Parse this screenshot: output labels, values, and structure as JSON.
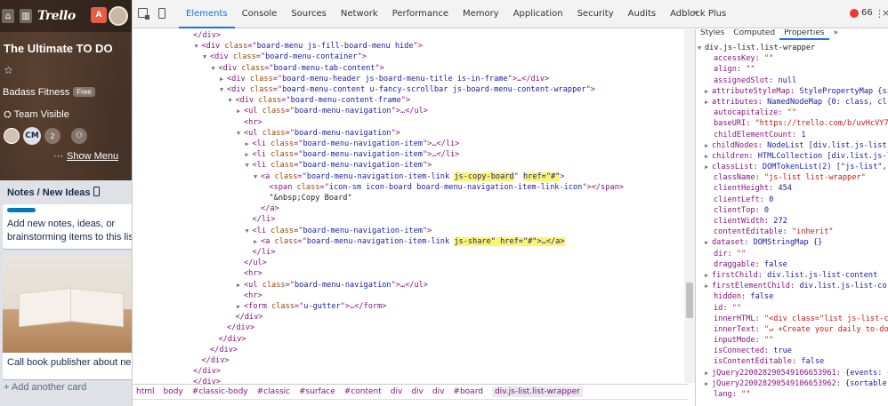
{
  "trello": {
    "logo": "Trello",
    "notif_count": "A",
    "board_title": "The Ultimate TO DO",
    "team_name": "Badass Fitness",
    "free_badge": "Free",
    "visibility": "Team Visible",
    "member_initials": "CM",
    "member_count": "2",
    "show_menu": "Show Menu",
    "show_menu_icon": "···",
    "list_title": "Notes / New Ideas",
    "card1_line1": "Add new notes, ideas, or",
    "card1_line2": "brainstorming items to this lis",
    "card2_text": "Call book publisher about ne",
    "add_card": "+ Add another card",
    "accent_color": "#0079bf"
  },
  "devtools": {
    "tabs": [
      "Elements",
      "Console",
      "Sources",
      "Network",
      "Performance",
      "Memory",
      "Application",
      "Security",
      "Audits",
      "Adblock Plus"
    ],
    "active_tab": "Elements",
    "more_tabs": "»",
    "error_count": "66",
    "kebab": "⋮",
    "close": "×",
    "code_lines": [
      {
        "i": 0,
        "tw": "",
        "parts": [
          [
            "tag",
            "</div>"
          ]
        ]
      },
      {
        "i": 1,
        "tw": "▼",
        "parts": [
          [
            "tag",
            "<div "
          ],
          [
            "attr",
            "class"
          ],
          [
            "tag",
            "=\""
          ],
          [
            "val",
            "board-menu js-fill-board-menu hide"
          ],
          [
            "tag",
            "\">"
          ]
        ]
      },
      {
        "i": 2,
        "tw": "▼",
        "parts": [
          [
            "tag",
            "<div "
          ],
          [
            "attr",
            "class"
          ],
          [
            "tag",
            "=\""
          ],
          [
            "val",
            "board-menu-container"
          ],
          [
            "tag",
            "\">"
          ]
        ]
      },
      {
        "i": 3,
        "tw": "▼",
        "parts": [
          [
            "tag",
            "<div "
          ],
          [
            "attr",
            "class"
          ],
          [
            "tag",
            "=\""
          ],
          [
            "val",
            "board-menu-tab-content"
          ],
          [
            "tag",
            "\">"
          ]
        ]
      },
      {
        "i": 4,
        "tw": "▶",
        "parts": [
          [
            "tag",
            "<div "
          ],
          [
            "attr",
            "class"
          ],
          [
            "tag",
            "=\""
          ],
          [
            "val",
            "board-menu-header js-board-menu-title is-in-frame"
          ],
          [
            "tag",
            "\">…</div>"
          ]
        ]
      },
      {
        "i": 4,
        "tw": "▼",
        "parts": [
          [
            "tag",
            "<div "
          ],
          [
            "attr",
            "class"
          ],
          [
            "tag",
            "=\""
          ],
          [
            "val",
            "board-menu-content u-fancy-scrollbar js-board-menu-content-wrapper"
          ],
          [
            "tag",
            "\">"
          ]
        ]
      },
      {
        "i": 5,
        "tw": "▼",
        "parts": [
          [
            "tag",
            "<div "
          ],
          [
            "attr",
            "class"
          ],
          [
            "tag",
            "=\""
          ],
          [
            "val",
            "board-menu-content-frame"
          ],
          [
            "tag",
            "\">"
          ]
        ]
      },
      {
        "i": 6,
        "tw": "▶",
        "parts": [
          [
            "tag",
            "<ul "
          ],
          [
            "attr",
            "class"
          ],
          [
            "tag",
            "=\""
          ],
          [
            "val",
            "board-menu-navigation"
          ],
          [
            "tag",
            "\">…</ul>"
          ]
        ]
      },
      {
        "i": 6,
        "tw": "",
        "parts": [
          [
            "tag",
            "<hr>"
          ]
        ]
      },
      {
        "i": 6,
        "tw": "▼",
        "parts": [
          [
            "tag",
            "<ul "
          ],
          [
            "attr",
            "class"
          ],
          [
            "tag",
            "=\""
          ],
          [
            "val",
            "board-menu-navigation"
          ],
          [
            "tag",
            "\">"
          ]
        ]
      },
      {
        "i": 7,
        "tw": "▶",
        "parts": [
          [
            "tag",
            "<li "
          ],
          [
            "attr",
            "class"
          ],
          [
            "tag",
            "=\""
          ],
          [
            "val",
            "board-menu-navigation-item"
          ],
          [
            "tag",
            "\">…</li>"
          ]
        ]
      },
      {
        "i": 7,
        "tw": "▶",
        "parts": [
          [
            "tag",
            "<li "
          ],
          [
            "attr",
            "class"
          ],
          [
            "tag",
            "=\""
          ],
          [
            "val",
            "board-menu-navigation-item"
          ],
          [
            "tag",
            "\">…</li>"
          ]
        ]
      },
      {
        "i": 7,
        "tw": "▼",
        "parts": [
          [
            "tag",
            "<li "
          ],
          [
            "attr",
            "class"
          ],
          [
            "tag",
            "=\""
          ],
          [
            "val",
            "board-menu-navigation-item"
          ],
          [
            "tag",
            "\">"
          ]
        ]
      },
      {
        "i": 8,
        "tw": "▼",
        "parts": [
          [
            "tag",
            "<a "
          ],
          [
            "attr",
            "class"
          ],
          [
            "tag",
            "=\""
          ],
          [
            "val",
            "board-menu-navigation-item-link "
          ],
          [
            "hl",
            "js-copy-board"
          ],
          [
            "tag",
            "\" "
          ],
          [
            "hl",
            "href=\"#\""
          ],
          [
            "tag",
            ">"
          ]
        ]
      },
      {
        "i": 9,
        "tw": "",
        "parts": [
          [
            "tag",
            "<span "
          ],
          [
            "attr",
            "class"
          ],
          [
            "tag",
            "=\""
          ],
          [
            "val",
            "icon-sm icon-board board-menu-navigation-item-link-icon"
          ],
          [
            "tag",
            "\"></span>"
          ]
        ]
      },
      {
        "i": 9,
        "tw": "",
        "parts": [
          [
            "txt",
            "\"&nbsp;Copy Board\""
          ]
        ]
      },
      {
        "i": 8,
        "tw": "",
        "parts": [
          [
            "tag",
            "</a>"
          ]
        ]
      },
      {
        "i": 7,
        "tw": "",
        "parts": [
          [
            "tag",
            "</li>"
          ]
        ]
      },
      {
        "i": 7,
        "tw": "▼",
        "parts": [
          [
            "tag",
            "<li "
          ],
          [
            "attr",
            "class"
          ],
          [
            "tag",
            "=\""
          ],
          [
            "val",
            "board-menu-navigation-item"
          ],
          [
            "tag",
            "\">"
          ]
        ]
      },
      {
        "i": 8,
        "tw": "▶",
        "parts": [
          [
            "tag",
            "<a "
          ],
          [
            "attr",
            "class"
          ],
          [
            "tag",
            "=\""
          ],
          [
            "val",
            "board-menu-navigation-item-link "
          ],
          [
            "hl",
            "js-share\" href=\"#\">…</a>"
          ]
        ]
      },
      {
        "i": 7,
        "tw": "",
        "parts": [
          [
            "tag",
            "</li>"
          ]
        ]
      },
      {
        "i": 6,
        "tw": "",
        "parts": [
          [
            "tag",
            "</ul>"
          ]
        ]
      },
      {
        "i": 6,
        "tw": "",
        "parts": [
          [
            "tag",
            "<hr>"
          ]
        ]
      },
      {
        "i": 6,
        "tw": "▶",
        "parts": [
          [
            "tag",
            "<ul "
          ],
          [
            "attr",
            "class"
          ],
          [
            "tag",
            "=\""
          ],
          [
            "val",
            "board-menu-navigation"
          ],
          [
            "tag",
            "\">…</ul>"
          ]
        ]
      },
      {
        "i": 6,
        "tw": "",
        "parts": [
          [
            "tag",
            "<hr>"
          ]
        ]
      },
      {
        "i": 6,
        "tw": "▶",
        "parts": [
          [
            "tag",
            "<form "
          ],
          [
            "attr",
            "class"
          ],
          [
            "tag",
            "=\""
          ],
          [
            "val",
            "u-gutter"
          ],
          [
            "tag",
            "\">…</form>"
          ]
        ]
      },
      {
        "i": 5,
        "tw": "",
        "parts": [
          [
            "tag",
            "</div>"
          ]
        ]
      },
      {
        "i": 4,
        "tw": "",
        "parts": [
          [
            "tag",
            "</div>"
          ]
        ]
      },
      {
        "i": 3,
        "tw": "",
        "parts": [
          [
            "tag",
            "</div>"
          ]
        ]
      },
      {
        "i": 2,
        "tw": "",
        "parts": [
          [
            "tag",
            "</div>"
          ]
        ]
      },
      {
        "i": 1,
        "tw": "",
        "parts": [
          [
            "tag",
            "</div>"
          ]
        ]
      },
      {
        "i": 0,
        "tw": "",
        "parts": [
          [
            "tag",
            "</div>"
          ]
        ]
      },
      {
        "i": 0,
        "tw": "",
        "parts": [
          [
            "tag",
            "</div>"
          ]
        ]
      }
    ],
    "breadcrumbs": [
      "html",
      "body",
      "#classic-body",
      "#classic",
      "#surface",
      "#content",
      "div",
      "div",
      "div",
      "#board",
      "div.js-list.list-wrapper"
    ],
    "selected_breadcrumb": "div.js-list.list-wrapper",
    "props_tabs": [
      "Styles",
      "Computed",
      "Properties",
      "»"
    ],
    "active_props_tab": "Properties",
    "props": [
      {
        "tw": "▼",
        "k": "div.js-list.list-wrapper",
        "v": "",
        "t": "pkey"
      },
      {
        "tw": "",
        "k": "accessKey: ",
        "v": "\"\"",
        "t": "pstr"
      },
      {
        "tw": "",
        "k": "align: ",
        "v": "\"\"",
        "t": "pstr"
      },
      {
        "tw": "",
        "k": "assignedSlot: ",
        "v": "null",
        "t": "pval"
      },
      {
        "tw": "▶",
        "k": "attributeStyleMap: ",
        "v": "StylePropertyMap {si",
        "t": "pval"
      },
      {
        "tw": "▶",
        "k": "attributes: ",
        "v": "NamedNodeMap {0: class, cl",
        "t": "pval"
      },
      {
        "tw": "",
        "k": "autocapitalize: ",
        "v": "\"\"",
        "t": "pstr"
      },
      {
        "tw": "",
        "k": "baseURI: ",
        "v": "\"https://trello.com/b/uvHcVY7",
        "t": "pstr"
      },
      {
        "tw": "",
        "k": "childElementCount: ",
        "v": "1",
        "t": "pval"
      },
      {
        "tw": "▶",
        "k": "childNodes: ",
        "v": "NodeList [div.list.js-list",
        "t": "pval"
      },
      {
        "tw": "▶",
        "k": "children: ",
        "v": "HTMLCollection [div.list.js-l",
        "t": "pval"
      },
      {
        "tw": "▶",
        "k": "classList: ",
        "v": "DOMTokenList(2) [\"js-list\",",
        "t": "pval"
      },
      {
        "tw": "",
        "k": "className: ",
        "v": "\"js-list list-wrapper\"",
        "t": "pstr"
      },
      {
        "tw": "",
        "k": "clientHeight: ",
        "v": "454",
        "t": "pval"
      },
      {
        "tw": "",
        "k": "clientLeft: ",
        "v": "0",
        "t": "pval"
      },
      {
        "tw": "",
        "k": "clientTop: ",
        "v": "0",
        "t": "pval"
      },
      {
        "tw": "",
        "k": "clientWidth: ",
        "v": "272",
        "t": "pval"
      },
      {
        "tw": "",
        "k": "contentEditable: ",
        "v": "\"inherit\"",
        "t": "pstr"
      },
      {
        "tw": "▶",
        "k": "dataset: ",
        "v": "DOMStringMap {}",
        "t": "pval"
      },
      {
        "tw": "",
        "k": "dir: ",
        "v": "\"\"",
        "t": "pstr"
      },
      {
        "tw": "",
        "k": "draggable: ",
        "v": "false",
        "t": "pval"
      },
      {
        "tw": "▶",
        "k": "firstChild: ",
        "v": "div.list.js-list-content",
        "t": "pval"
      },
      {
        "tw": "▶",
        "k": "firstElementChild: ",
        "v": "div.list.js-list-co",
        "t": "pval"
      },
      {
        "tw": "",
        "k": "hidden: ",
        "v": "false",
        "t": "pval"
      },
      {
        "tw": "",
        "k": "id: ",
        "v": "\"\"",
        "t": "pstr"
      },
      {
        "tw": "",
        "k": "innerHTML: ",
        "v": "\"<div class=\"list js-list-c",
        "t": "pstr"
      },
      {
        "tw": "",
        "k": "innerText: ",
        "v": "\"↵ +Create your daily to-do",
        "t": "pstr"
      },
      {
        "tw": "",
        "k": "inputMode: ",
        "v": "\"\"",
        "t": "pstr"
      },
      {
        "tw": "",
        "k": "isConnected: ",
        "v": "true",
        "t": "pval"
      },
      {
        "tw": "",
        "k": "isContentEditable: ",
        "v": "false",
        "t": "pval"
      },
      {
        "tw": "▶",
        "k": "jQuery220028290549106653961: ",
        "v": "{events: {",
        "t": "pval"
      },
      {
        "tw": "▶",
        "k": "jQuery220028290549106653962: ",
        "v": "{sortable",
        "t": "pval"
      },
      {
        "tw": "",
        "k": "lang: ",
        "v": "\"\"",
        "t": "pstr"
      }
    ]
  }
}
